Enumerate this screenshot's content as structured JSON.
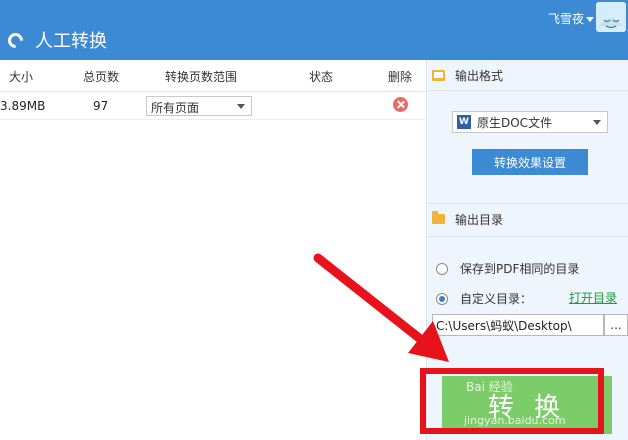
{
  "header": {
    "title": "人工转换",
    "user_name": "飞雪夜"
  },
  "table": {
    "columns": [
      "大小",
      "总页数",
      "转换页数范围",
      "状态",
      "删除"
    ],
    "rows": [
      {
        "size": "3.89MB",
        "pages": "97",
        "range": "所有页面",
        "status": ""
      }
    ]
  },
  "output_format": {
    "title": "输出格式",
    "selected": "原生DOC文件",
    "doc_icon_label": "W",
    "settings_label": "转换效果设置"
  },
  "output_dir": {
    "title": "输出目录",
    "option_same": "保存到PDF相同的目录",
    "option_custom": "自定义目录：",
    "open_link": "打开目录",
    "path": "C:\\Users\\蚂蚁\\Desktop\\",
    "browse_label": "..."
  },
  "convert": {
    "label": "转 换"
  },
  "watermark": {
    "main": "Bai 经验",
    "sub": "jingyan.baidu.com"
  },
  "colors": {
    "header": "#3c8ad4",
    "panel": "#eef5fc",
    "convert": "#7ccc6a",
    "highlight": "#e8121b",
    "link": "#1a9e3a"
  },
  "icons": {
    "refresh": "refresh-icon",
    "delete": "delete-icon",
    "folder": "folder-icon",
    "doc": "word-doc-icon",
    "arrow": "red-arrow-annotation"
  }
}
